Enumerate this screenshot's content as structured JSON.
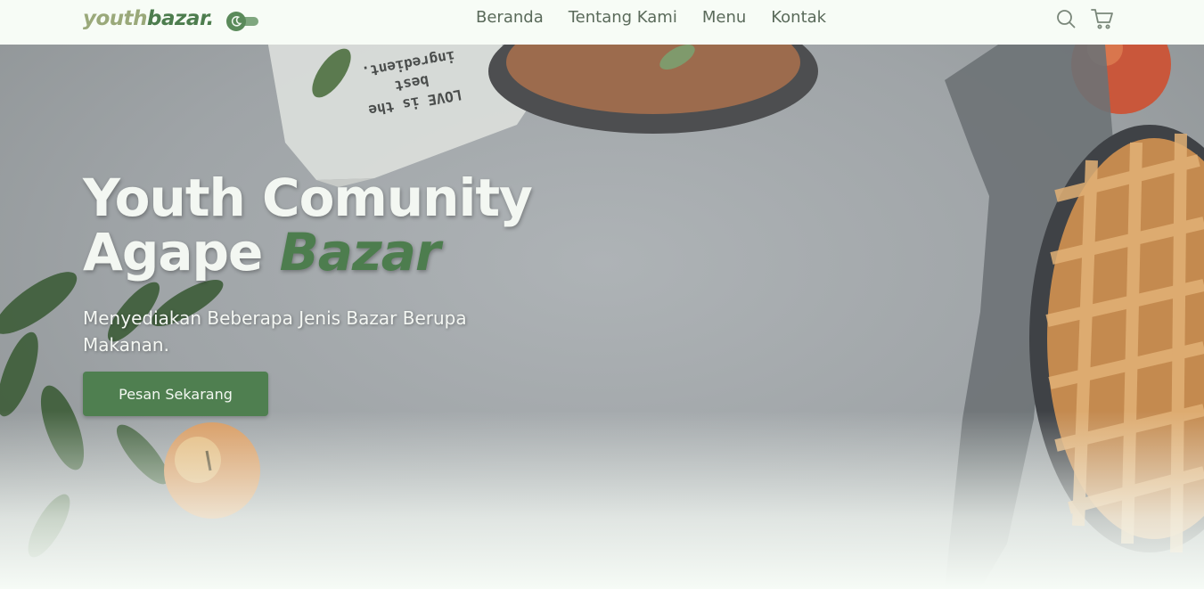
{
  "brand": {
    "prefix": "youth",
    "accent": "bazar",
    "dot": "."
  },
  "nav": {
    "items": [
      "Beranda",
      "Tentang Kami",
      "Menu",
      "Kontak"
    ]
  },
  "icons": {
    "theme_toggle": "moon-toggle-icon",
    "search": "search-icon",
    "cart": "cart-icon"
  },
  "hero": {
    "title_line1": "Youth Comunity",
    "title_line2_plain": "Agape ",
    "title_line2_accent": "Bazar",
    "subtitle": "Menyediakan Beberapa Jenis Bazar Berupa Makanan.",
    "cta_label": "Pesan Sekarang",
    "napkin_text_1": "LOVE is the",
    "napkin_text_2": "best ingredient."
  },
  "colors": {
    "brand_green": "#4d7d4e",
    "nav_text": "#5a6a5a",
    "background": "#f6fbf6"
  }
}
